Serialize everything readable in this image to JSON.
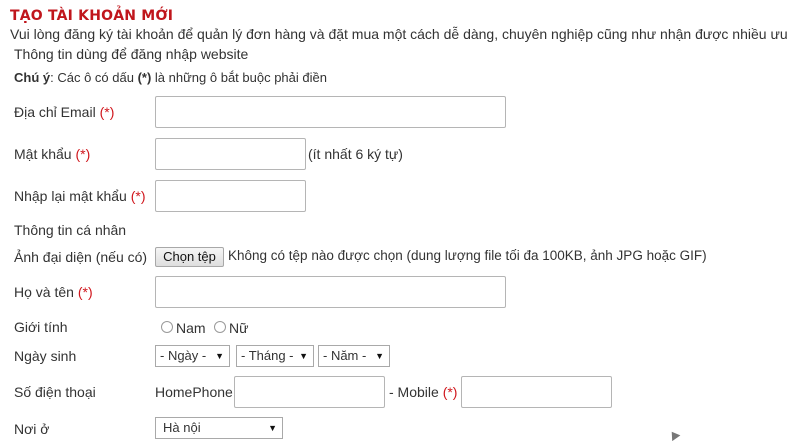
{
  "form": {
    "title": "TẠO TÀI KHOẢN MỚI",
    "intro": "Vui lòng đăng ký tài khoản để quản lý đơn hàng và đặt mua một cách dễ dàng, chuyên nghiệp cũng như nhận được nhiều ưu đ",
    "login_section": "Thông tin dùng để đăng nhập website",
    "note_label": "Chú ý",
    "note_text_1": ": Các ô có dấu ",
    "note_mark": "(*)",
    "note_text_2": " là những ô bắt buộc phải điền",
    "required_mark": "(*)",
    "email_label": "Địa chỉ Email",
    "password_label": "Mật khẩu",
    "password_hint": "(ít nhất 6 ký tự)",
    "confirm_label": "Nhập lại mật khẩu",
    "personal_section": "Thông tin cá nhân",
    "avatar_label": "Ảnh đại diện (nếu có)",
    "file_button": "Chọn tệp",
    "file_status": "Không có tệp nào được chọn",
    "file_hint": "(dung lượng file tối đa 100KB, ảnh JPG hoặc GIF)",
    "name_label": "Họ và tên",
    "gender_label": "Giới tính",
    "gender_male": "Nam",
    "gender_female": "Nữ",
    "birthday_label": "Ngày sinh",
    "day_select": "- Ngày -",
    "month_select": "- Tháng -",
    "year_select": "- Năm -",
    "phone_label": "Số điện thoại",
    "homephone_label": "HomePhone",
    "mobile_label": "- Mobile",
    "city_label": "Nơi ở",
    "city_select": "Hà nội"
  },
  "icons": {
    "select_arrow": "dropdown-arrow-icon",
    "arrow_glyph": "▼"
  },
  "colors": {
    "title": "#c0161c",
    "required": "#d0161c",
    "text": "#333333"
  }
}
